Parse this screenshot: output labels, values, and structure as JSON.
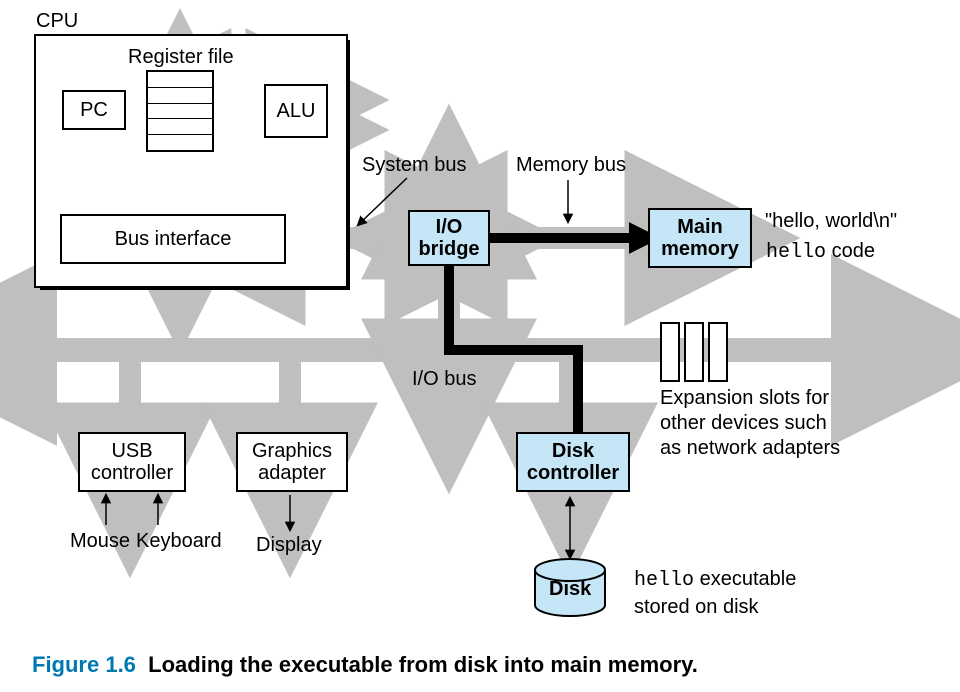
{
  "cpu_label": "CPU",
  "regfile_label": "Register file",
  "pc_label": "PC",
  "alu_label": "ALU",
  "businterface_label": "Bus interface",
  "systembus_label": "System bus",
  "memorybus_label": "Memory bus",
  "iobridge_line1": "I/O",
  "iobridge_line2": "bridge",
  "mainmem_line1": "Main",
  "mainmem_line2": "memory",
  "annot_hello_world": "\"hello, world\\n\"",
  "annot_hello_code_prefix": "hello",
  "annot_hello_code_suffix": " code",
  "iobus_label": "I/O bus",
  "usb_line1": "USB",
  "usb_line2": "controller",
  "graphics_line1": "Graphics",
  "graphics_line2": "adapter",
  "diskctl_line1": "Disk",
  "diskctl_line2": "controller",
  "expansion_line1": "Expansion slots for",
  "expansion_line2": "other devices such",
  "expansion_line3": "as network adapters",
  "mouse_label": "Mouse",
  "keyboard_label": "Keyboard",
  "display_label": "Display",
  "disk_label": "Disk",
  "disk_annot_prefix": "hello",
  "disk_annot_line1_suffix": " executable",
  "disk_annot_line2": "stored on disk",
  "figure_number": "Figure 1.6",
  "figure_title": "Loading the executable from disk into main memory.",
  "colors": {
    "bus_fill": "#bfbfbf",
    "blue_fill": "#c5e6f6",
    "caption_blue": "#0079b3",
    "black_arrow": "#000000"
  }
}
